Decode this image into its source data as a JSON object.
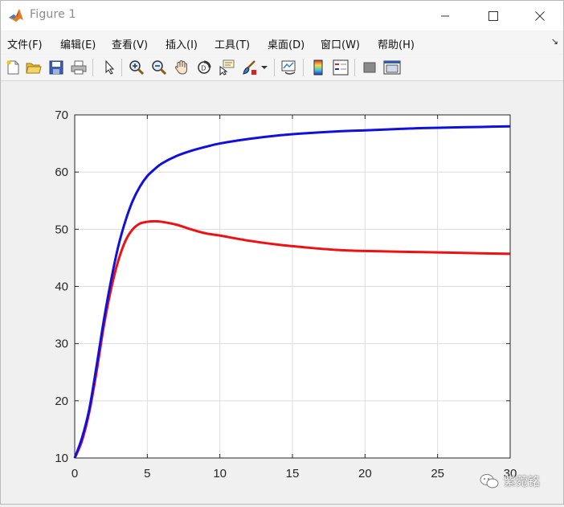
{
  "window": {
    "title": "Figure 1"
  },
  "menu": {
    "items": [
      {
        "label": "文件(F)",
        "name": "menu-file"
      },
      {
        "label": "编辑(E)",
        "name": "menu-edit"
      },
      {
        "label": "查看(V)",
        "name": "menu-view"
      },
      {
        "label": "插入(I)",
        "name": "menu-insert"
      },
      {
        "label": "工具(T)",
        "name": "menu-tools"
      },
      {
        "label": "桌面(D)",
        "name": "menu-desktop"
      },
      {
        "label": "窗口(W)",
        "name": "menu-window"
      },
      {
        "label": "帮助(H)",
        "name": "menu-help"
      }
    ]
  },
  "toolbar": {
    "icons": [
      "new-figure-icon",
      "open-file-icon",
      "save-icon",
      "print-icon",
      "select-arrow-icon",
      "zoom-in-icon",
      "zoom-out-icon",
      "pan-hand-icon",
      "rotate-3d-icon",
      "data-cursor-icon",
      "brush-icon",
      "brush-dropdown-icon",
      "link-plot-icon",
      "colorbar-icon",
      "legend-icon",
      "hide-plot-tools-icon",
      "show-plot-tools-icon"
    ]
  },
  "colors": {
    "series_red": "#ee1111",
    "series_blue": "#1010dd",
    "grid": "#dcdcdc"
  },
  "watermark": {
    "text": "紫菀铭"
  },
  "chart_data": {
    "type": "line",
    "xlim": [
      0,
      30
    ],
    "ylim": [
      10,
      70
    ],
    "xticks": [
      0,
      5,
      10,
      15,
      20,
      25,
      30
    ],
    "yticks": [
      10,
      20,
      30,
      40,
      50,
      60,
      70
    ],
    "grid": true,
    "series": [
      {
        "color": "#1010dd",
        "x": [
          0,
          0.5,
          1,
          1.5,
          2,
          2.5,
          3,
          3.5,
          4,
          4.5,
          5,
          5.5,
          6,
          7,
          8,
          9,
          10,
          12,
          14,
          16,
          18,
          20,
          22,
          24,
          26,
          28,
          30
        ],
        "y": [
          10,
          13.5,
          18.5,
          26,
          34,
          41,
          47,
          51.5,
          55,
          57.5,
          59.3,
          60.5,
          61.5,
          62.8,
          63.7,
          64.4,
          65,
          65.8,
          66.4,
          66.8,
          67.1,
          67.3,
          67.5,
          67.7,
          67.8,
          67.9,
          68
        ]
      },
      {
        "color": "#ee1111",
        "x": [
          0,
          0.5,
          1,
          1.5,
          2,
          2.5,
          3,
          3.5,
          4,
          4.5,
          5,
          5.5,
          6,
          7,
          8,
          9,
          10,
          12,
          14,
          16,
          18,
          20,
          22,
          24,
          26,
          28,
          30
        ],
        "y": [
          10,
          13,
          18,
          25,
          33,
          39.5,
          44.5,
          48,
          50,
          51,
          51.3,
          51.4,
          51.3,
          50.8,
          50,
          49.3,
          48.9,
          48,
          47.3,
          46.8,
          46.4,
          46.2,
          46.1,
          46,
          45.9,
          45.8,
          45.7
        ]
      }
    ]
  }
}
